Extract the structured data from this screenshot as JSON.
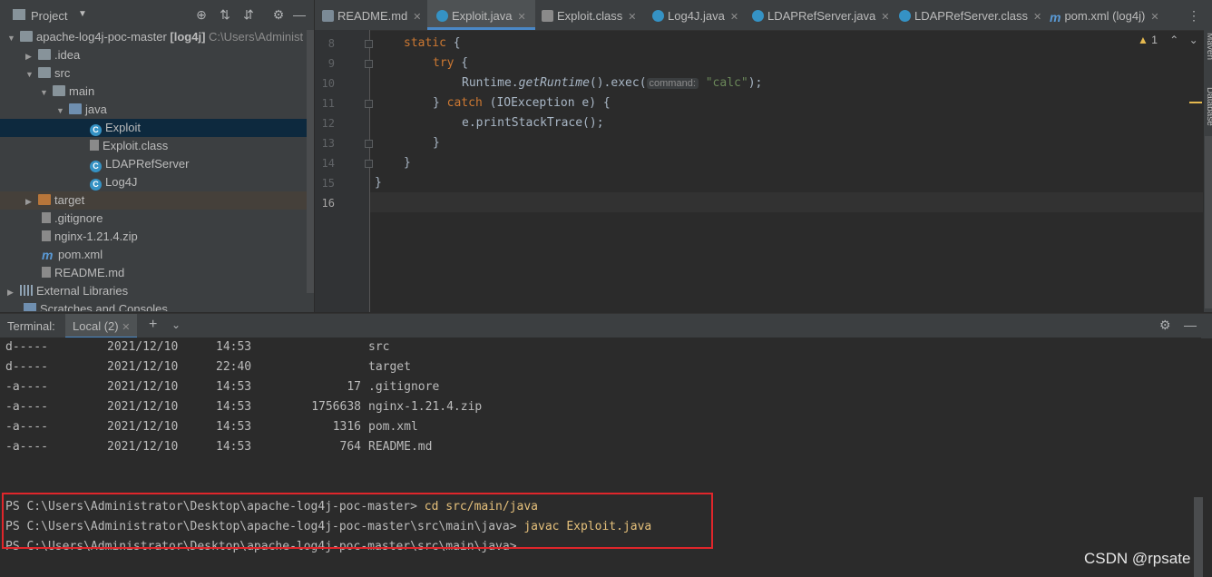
{
  "project_panel": {
    "title": "Project",
    "tree": [
      {
        "label": "apache-log4j-poc-master",
        "bold": "[log4j]",
        "path": "C:\\Users\\Administ",
        "level": 0,
        "expanded": true,
        "type": "module"
      },
      {
        "label": ".idea",
        "level": 1,
        "expanded": false,
        "type": "folder"
      },
      {
        "label": "src",
        "level": 1,
        "expanded": true,
        "type": "folder"
      },
      {
        "label": "main",
        "level": 2,
        "expanded": true,
        "type": "folder"
      },
      {
        "label": "java",
        "level": 3,
        "expanded": true,
        "type": "folder-blue"
      },
      {
        "label": "Exploit",
        "level": 4,
        "type": "class",
        "selected": true
      },
      {
        "label": "Exploit.class",
        "level": 4,
        "type": "class-file"
      },
      {
        "label": "LDAPRefServer",
        "level": 4,
        "type": "class"
      },
      {
        "label": "Log4J",
        "level": 4,
        "type": "class"
      },
      {
        "label": "target",
        "level": 1,
        "expanded": false,
        "type": "folder-orange"
      },
      {
        "label": ".gitignore",
        "level": 1,
        "type": "file"
      },
      {
        "label": "nginx-1.21.4.zip",
        "level": 1,
        "type": "file"
      },
      {
        "label": "pom.xml",
        "level": 1,
        "type": "maven"
      },
      {
        "label": "README.md",
        "level": 1,
        "type": "file"
      },
      {
        "label": "External Libraries",
        "level": 0,
        "expanded": false,
        "type": "library"
      },
      {
        "label": "Scratches and Consoles",
        "level": 0,
        "type": "scratch"
      }
    ]
  },
  "tabs": [
    {
      "label": "README.md",
      "icon": "markdown-icon"
    },
    {
      "label": "Exploit.java",
      "icon": "class-icon",
      "active": true
    },
    {
      "label": "Exploit.class",
      "icon": "class-file-icon"
    },
    {
      "label": "Log4J.java",
      "icon": "class-icon"
    },
    {
      "label": "LDAPRefServer.java",
      "icon": "class-icon"
    },
    {
      "label": "LDAPRefServer.class",
      "icon": "class-icon"
    },
    {
      "label": "pom.xml (log4j)",
      "icon": "maven-icon"
    }
  ],
  "editor": {
    "warning_count": "1",
    "lines": [
      {
        "num": "8"
      },
      {
        "num": "9"
      },
      {
        "num": "10"
      },
      {
        "num": "11"
      },
      {
        "num": "12"
      },
      {
        "num": "13"
      },
      {
        "num": "14"
      },
      {
        "num": "15"
      },
      {
        "num": "16"
      }
    ],
    "code": {
      "l8_kw": "static",
      "l8_rest": " {",
      "l9_kw": "try",
      "l9_rest": " {",
      "l10_a": "Runtime.",
      "l10_b": "getRuntime",
      "l10_c": "().exec(",
      "l10_hint": "command:",
      "l10_str": "\"calc\"",
      "l10_d": ");",
      "l11_a": "} ",
      "l11_kw": "catch",
      "l11_b": " (IOException e) {",
      "l12": "e.printStackTrace();",
      "l13": "}",
      "l14": "}",
      "l15": "}"
    }
  },
  "terminal": {
    "title": "Terminal:",
    "tab": "Local (2)",
    "listing": [
      {
        "mode": "d-----",
        "date": "2021/12/10",
        "time": "14:53",
        "size": "",
        "name": "src"
      },
      {
        "mode": "d-----",
        "date": "2021/12/10",
        "time": "22:40",
        "size": "",
        "name": "target"
      },
      {
        "mode": "-a----",
        "date": "2021/12/10",
        "time": "14:53",
        "size": "17",
        "name": ".gitignore"
      },
      {
        "mode": "-a----",
        "date": "2021/12/10",
        "time": "14:53",
        "size": "1756638",
        "name": "nginx-1.21.4.zip"
      },
      {
        "mode": "-a----",
        "date": "2021/12/10",
        "time": "14:53",
        "size": "1316",
        "name": "pom.xml"
      },
      {
        "mode": "-a----",
        "date": "2021/12/10",
        "time": "14:53",
        "size": "764",
        "name": "README.md"
      }
    ],
    "prompts": [
      {
        "prompt": "PS C:\\Users\\Administrator\\Desktop\\apache-log4j-poc-master> ",
        "cmd": "cd src/main/java"
      },
      {
        "prompt": "PS C:\\Users\\Administrator\\Desktop\\apache-log4j-poc-master\\src\\main\\java> ",
        "cmd": "javac Exploit.java"
      },
      {
        "prompt": "PS C:\\Users\\Administrator\\Desktop\\apache-log4j-poc-master\\src\\main\\java>",
        "cmd": ""
      }
    ]
  },
  "side_tools": {
    "maven": "Maven",
    "database": "Database"
  },
  "watermark": "CSDN @rpsate",
  "colors": {
    "highlight": "#e0262b",
    "accent": "#4a88c7",
    "keyword": "#cc7832",
    "string": "#6a8759"
  }
}
